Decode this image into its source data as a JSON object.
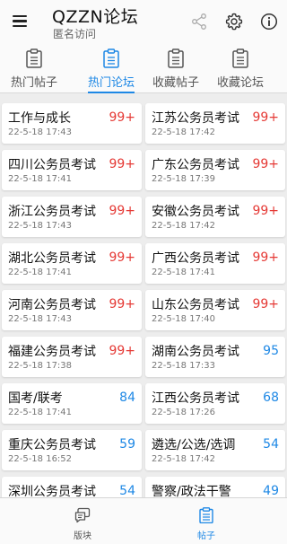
{
  "header": {
    "title": "QZZN论坛",
    "subtitle": "匿名访问",
    "icons": [
      "menu-icon",
      "share-icon",
      "gear-icon",
      "info-icon"
    ]
  },
  "tabs": [
    {
      "label": "热门帖子",
      "icon": "clipboard-icon",
      "active": false
    },
    {
      "label": "热门论坛",
      "icon": "clipboard-icon",
      "active": true
    },
    {
      "label": "收藏帖子",
      "icon": "clipboard-icon",
      "active": false
    },
    {
      "label": "收藏论坛",
      "icon": "clipboard-icon",
      "active": false
    }
  ],
  "forums": [
    {
      "name": "工作与成长",
      "time": "22-5-18 17:43",
      "count": "99+",
      "hot": true
    },
    {
      "name": "江苏公务员考试",
      "time": "22-5-18 17:42",
      "count": "99+",
      "hot": true
    },
    {
      "name": "四川公务员考试",
      "time": "22-5-18 17:41",
      "count": "99+",
      "hot": true
    },
    {
      "name": "广东公务员考试",
      "time": "22-5-18 17:39",
      "count": "99+",
      "hot": true
    },
    {
      "name": "浙江公务员考试",
      "time": "22-5-18 17:43",
      "count": "99+",
      "hot": true
    },
    {
      "name": "安徽公务员考试",
      "time": "22-5-18 17:42",
      "count": "99+",
      "hot": true
    },
    {
      "name": "湖北公务员考试",
      "time": "22-5-18 17:41",
      "count": "99+",
      "hot": true
    },
    {
      "name": "广西公务员考试",
      "time": "22-5-18 17:41",
      "count": "99+",
      "hot": true
    },
    {
      "name": "河南公务员考试",
      "time": "22-5-18 17:43",
      "count": "99+",
      "hot": true
    },
    {
      "name": "山东公务员考试",
      "time": "22-5-18 17:40",
      "count": "99+",
      "hot": true
    },
    {
      "name": "福建公务员考试",
      "time": "22-5-18 17:38",
      "count": "99+",
      "hot": true
    },
    {
      "name": "湖南公务员考试",
      "time": "22-5-18 17:33",
      "count": "95",
      "hot": false
    },
    {
      "name": "国考/联考",
      "time": "22-5-18 17:41",
      "count": "84",
      "hot": false
    },
    {
      "name": "江西公务员考试",
      "time": "22-5-18 17:26",
      "count": "68",
      "hot": false
    },
    {
      "name": "重庆公务员考试",
      "time": "22-5-18 16:52",
      "count": "59",
      "hot": false
    },
    {
      "name": "遴选/公选/选调",
      "time": "22-5-18 17:42",
      "count": "54",
      "hot": false
    },
    {
      "name": "深圳公务员考试",
      "time": "",
      "count": "54",
      "hot": false
    },
    {
      "name": "警察/政法干警",
      "time": "",
      "count": "49",
      "hot": false
    }
  ],
  "bottom_nav": [
    {
      "label": "版块",
      "icon": "chat-icon",
      "active": false
    },
    {
      "label": "帖子",
      "icon": "clipboard-icon",
      "active": true
    }
  ],
  "colors": {
    "accent": "#1e88e5",
    "hot": "#e53935"
  }
}
